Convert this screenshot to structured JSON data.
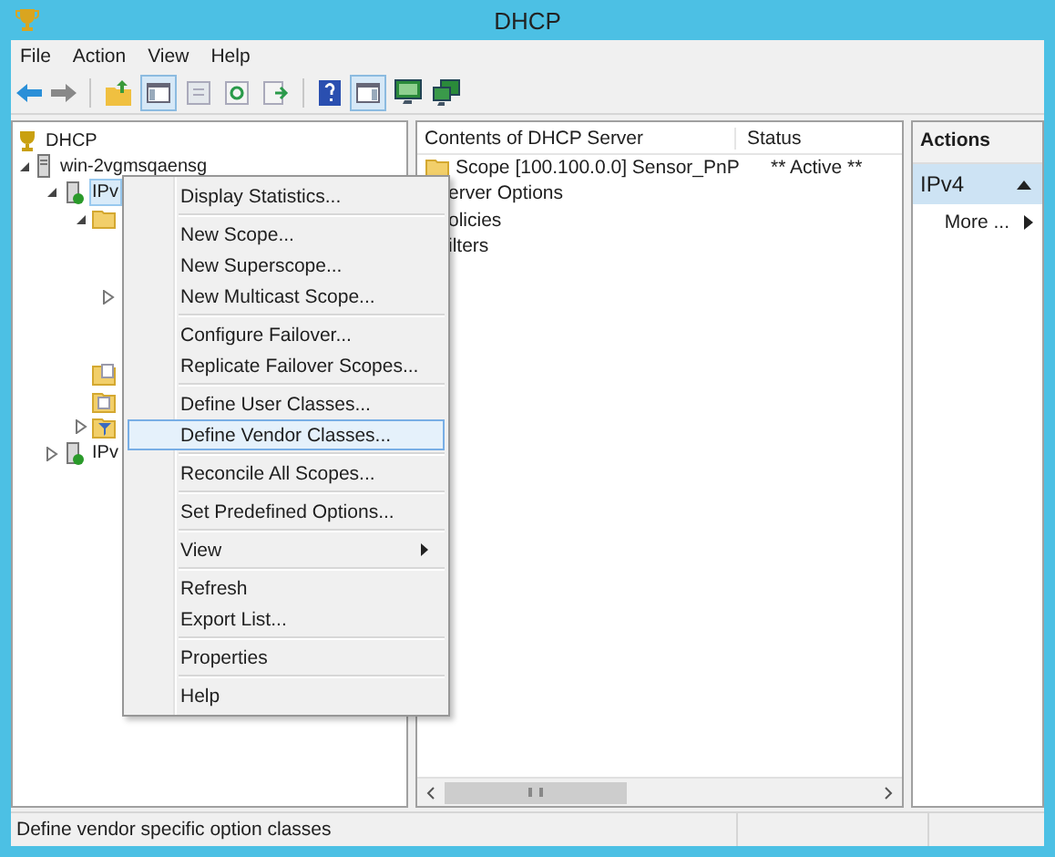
{
  "window": {
    "title": "DHCP"
  },
  "menu_bar": [
    "File",
    "Action",
    "View",
    "Help"
  ],
  "tree": [
    {
      "label": "DHCP",
      "kind": "dhcp",
      "children": [
        {
          "label": "win-2vgmsqaensg",
          "kind": "server",
          "expanded": true,
          "children": [
            {
              "label": "IPv",
              "kind": "ipv",
              "expanded": true,
              "selected": true,
              "children": [
                {
                  "kind": "folder",
                  "expanded": true,
                  "children": [
                    {
                      "expanded": false
                    }
                  ]
                },
                {
                  "kind": "options"
                },
                {
                  "kind": "policy"
                },
                {
                  "kind": "filter",
                  "expanded": false
                }
              ]
            },
            {
              "label": "IPv",
              "kind": "ipv",
              "expanded": false,
              "selected": false
            }
          ]
        }
      ]
    }
  ],
  "contents": {
    "columns": [
      "Contents of DHCP Server",
      "Status"
    ],
    "rows": [
      {
        "kind": "folder",
        "name": "Scope [100.100.0.0] Sensor_PnP",
        "status": "** Active **"
      },
      {
        "kind": "covered",
        "name": "erver Options"
      },
      {
        "kind": "covered",
        "name": "olicies"
      },
      {
        "kind": "covered",
        "name": "ilters"
      }
    ]
  },
  "actions": {
    "title": "Actions",
    "section": {
      "label": "IPv4",
      "expanded": true
    },
    "items": [
      {
        "label": "More ...",
        "has_submenu": true
      }
    ]
  },
  "context_menu": [
    [
      {
        "label": "Display Statistics...",
        "selected": false
      }
    ],
    [
      {
        "label": "New Scope...",
        "selected": false
      },
      {
        "label": "New Superscope...",
        "selected": false
      },
      {
        "label": "New Multicast Scope...",
        "selected": false
      }
    ],
    [
      {
        "label": "Configure Failover...",
        "selected": false
      },
      {
        "label": "Replicate Failover Scopes...",
        "selected": false
      }
    ],
    [
      {
        "label": "Define User Classes...",
        "selected": false
      },
      {
        "label": "Define Vendor Classes...",
        "selected": true
      }
    ],
    [
      {
        "label": "Reconcile All Scopes...",
        "selected": false
      }
    ],
    [
      {
        "label": "Set Predefined Options...",
        "selected": false
      }
    ],
    [
      {
        "label": "View",
        "selected": false,
        "has_submenu": true
      }
    ],
    [
      {
        "label": "Refresh",
        "selected": false
      },
      {
        "label": "Export List...",
        "selected": false
      }
    ],
    [
      {
        "label": "Properties",
        "selected": false
      }
    ],
    [
      {
        "label": "Help",
        "selected": false
      }
    ]
  ],
  "status_bar": "Define vendor specific option classes"
}
